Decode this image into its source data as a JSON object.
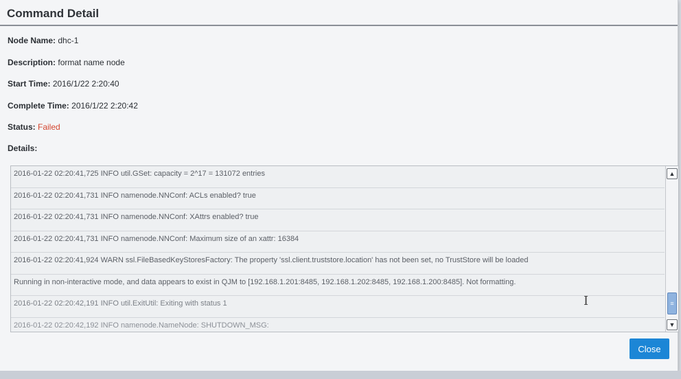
{
  "dialog": {
    "title": "Command Detail",
    "fields": {
      "node_name": {
        "label": "Node Name:",
        "value": "dhc-1"
      },
      "description": {
        "label": "Description:",
        "value": "format name node"
      },
      "start_time": {
        "label": "Start Time:",
        "value": "2016/1/22 2:20:40"
      },
      "complete_time": {
        "label": "Complete Time:",
        "value": "2016/1/22 2:20:42"
      },
      "status": {
        "label": "Status:",
        "value": "Failed"
      },
      "details": {
        "label": "Details:"
      }
    },
    "log_lines": [
      "2016-01-22 02:20:41,725 INFO util.GSet: capacity      = 2^17 = 131072 entries",
      "2016-01-22 02:20:41,731 INFO namenode.NNConf: ACLs enabled? true",
      "2016-01-22 02:20:41,731 INFO namenode.NNConf: XAttrs enabled? true",
      "2016-01-22 02:20:41,731 INFO namenode.NNConf: Maximum size of an xattr: 16384",
      "2016-01-22 02:20:41,924 WARN ssl.FileBasedKeyStoresFactory: The property 'ssl.client.truststore.location' has not been set, no TrustStore will be loaded",
      "Running in non-interactive mode, and data appears to exist in QJM to [192.168.1.201:8485, 192.168.1.202:8485, 192.168.1.200:8485]. Not formatting.",
      "2016-01-22 02:20:42,191 INFO util.ExitUtil: Exiting with status 1",
      "2016-01-22 02:20:42,192 INFO namenode.NameNode: SHUTDOWN_MSG:"
    ],
    "close_label": "Close",
    "status_color": "#d4462f",
    "accent_color": "#1c86d6"
  }
}
